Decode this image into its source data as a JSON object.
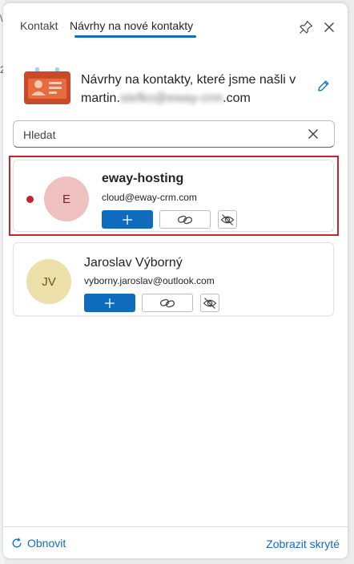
{
  "tabs": [
    {
      "label": "Kontakt"
    },
    {
      "label": "Návrhy na nové kontakty"
    }
  ],
  "icons": {
    "pin": "pin-icon",
    "close": "close-icon",
    "contact_card": "contact-card-icon",
    "edit": "pencil-icon",
    "clear": "close-icon",
    "add": "plus-icon",
    "link": "link-icon",
    "hide": "eye-off-icon",
    "refresh": "refresh-icon"
  },
  "header": {
    "line1": "Návrhy na kontakty, které jsme našli v",
    "line2_prefix": "martin.",
    "line2_blurred": "stefko@eway-crm",
    "line2_suffix": ".com"
  },
  "search": {
    "placeholder": "Hledat",
    "value": ""
  },
  "contacts": [
    {
      "initials": "E",
      "name": "eway-hosting",
      "email": "cloud@eway-crm.com",
      "unread": true,
      "avatar_color": "#efc0c0"
    },
    {
      "initials": "JV",
      "name": "Jaroslav Výborný",
      "email": "vyborny.jaroslav@outlook.com",
      "unread": false,
      "avatar_color": "#ecdfa9"
    }
  ],
  "footer": {
    "refresh_label": "Obnovit",
    "show_hidden_label": "Zobrazit skryté"
  },
  "colors": {
    "accent": "#0f6cbd",
    "highlight_border": "#c4262e",
    "unread_dot": "#c4262e"
  }
}
